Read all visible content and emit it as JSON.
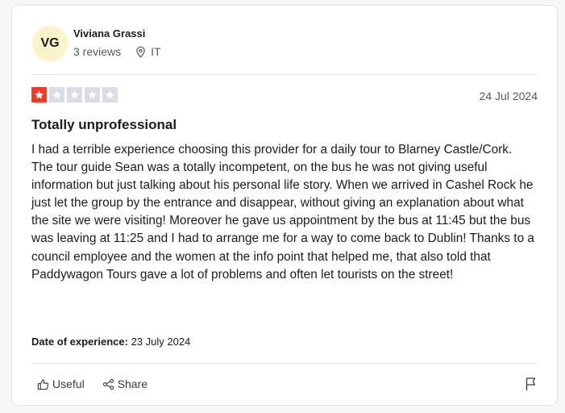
{
  "reviewer": {
    "initials": "VG",
    "name": "Viviana Grassi",
    "reviews": "3 reviews",
    "country": "IT",
    "location_icon": "map-pin-icon"
  },
  "review": {
    "rating": 1,
    "max_rating": 5,
    "date": "24 Jul 2024",
    "title": "Totally unprofessional",
    "body": "I had a terrible experience choosing this provider for a daily tour to Blarney Castle/Cork.\nThe tour guide Sean was a totally incompetent, on the bus he was not giving useful information but just talking about his personal life story. When we arrived in Cashel Rock he just let the group by the entrance and disappear, without giving an explanation about what the site we were visiting! Moreover he gave us appointment by the bus at 11:45 but the bus was leaving at 11:25 and I had to arrange me for a way to come back to Dublin! Thanks to a council employee and the women at the info point that helped me, that also told that Paddywagon Tours gave a lot of problems and often let tourists on the street!",
    "experience_label": "Date of experience:",
    "experience_date": "23 July 2024"
  },
  "actions": {
    "useful_label": "Useful",
    "share_label": "Share",
    "useful_icon": "thumbs-up-icon",
    "share_icon": "share-icon",
    "flag_icon": "flag-icon"
  },
  "colors": {
    "star_filled": "#ff3722",
    "star_empty": "#dcdce6",
    "avatar_bg": "#fbf3c9"
  }
}
